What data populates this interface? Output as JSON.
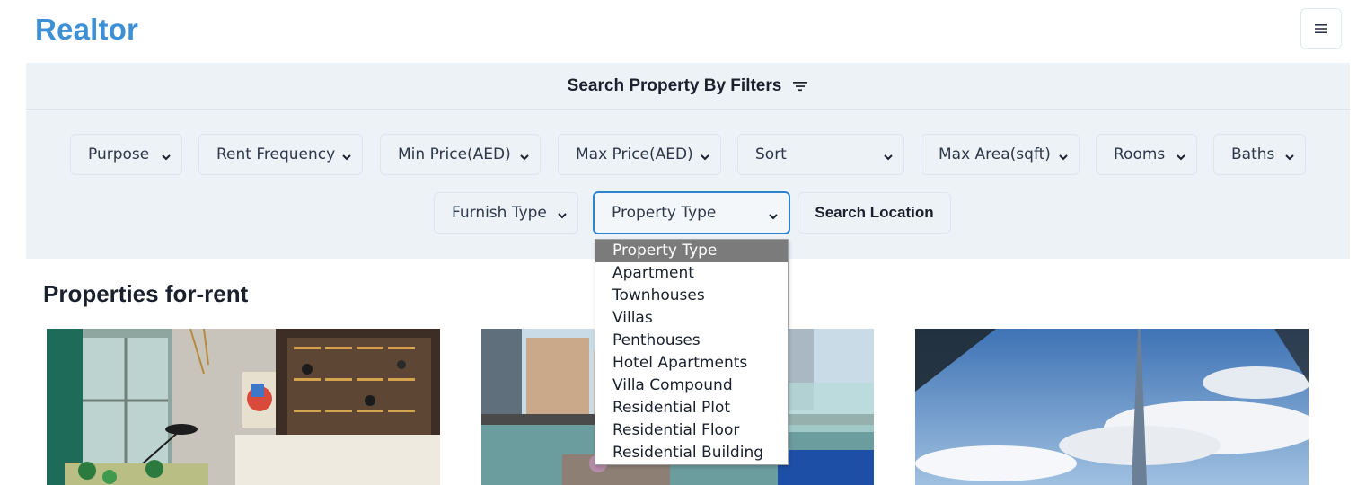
{
  "header": {
    "logo": "Realtor",
    "menu_icon": "hamburger-menu-icon"
  },
  "filters": {
    "title": "Search Property By Filters",
    "filter_icon": "filter-lines-icon",
    "selects": [
      {
        "label": "Purpose"
      },
      {
        "label": "Rent Frequency"
      },
      {
        "label": "Min Price(AED)"
      },
      {
        "label": "Max Price(AED)"
      },
      {
        "label": "Sort"
      },
      {
        "label": "Max Area(sqft)"
      },
      {
        "label": "Rooms"
      },
      {
        "label": "Baths"
      },
      {
        "label": "Furnish Type"
      },
      {
        "label": "Property Type"
      }
    ],
    "search_location_label": "Search Location"
  },
  "property_type_dropdown": {
    "selected": "Property Type",
    "options": [
      "Property Type",
      "Apartment",
      "Townhouses",
      "Villas",
      "Penthouses",
      "Hotel Apartments",
      "Villa Compound",
      "Residential Plot",
      "Residential Floor",
      "Residential Building"
    ]
  },
  "listing": {
    "title": "Properties for-rent"
  },
  "colors": {
    "brand": "#3d8fd6",
    "filter_bg": "#edf2f7",
    "focus_border": "#3182ce",
    "dropdown_highlight": "#7b7b7b"
  }
}
